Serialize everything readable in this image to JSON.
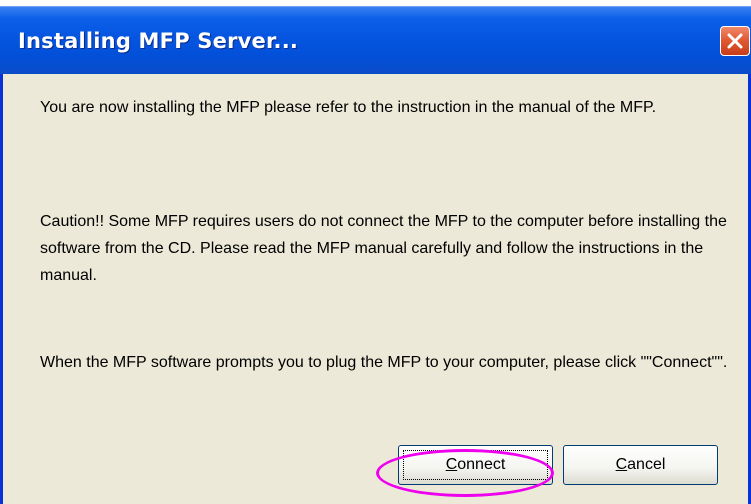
{
  "window": {
    "title": "Installing MFP Server...",
    "close_icon": "close-icon"
  },
  "message": {
    "paragraph1": "You are now installing the MFP please refer to the instruction in the manual of the MFP.",
    "paragraph2": "Caution!! Some MFP requires users do not connect the MFP to the computer before installing the software from the CD. Please read the MFP manual carefully and follow the instructions in the manual.",
    "paragraph3": " When the MFP  software prompts you to plug the MFP to your computer, please click \"\"Connect\"\"."
  },
  "buttons": {
    "connect_first": "C",
    "connect_rest": "onnect",
    "cancel_first": "C",
    "cancel_rest": "ancel"
  },
  "colors": {
    "titlebar": "#0655e0",
    "client": "#ece9d8",
    "close_button": "#e25a35",
    "highlight": "#ee00ee"
  }
}
